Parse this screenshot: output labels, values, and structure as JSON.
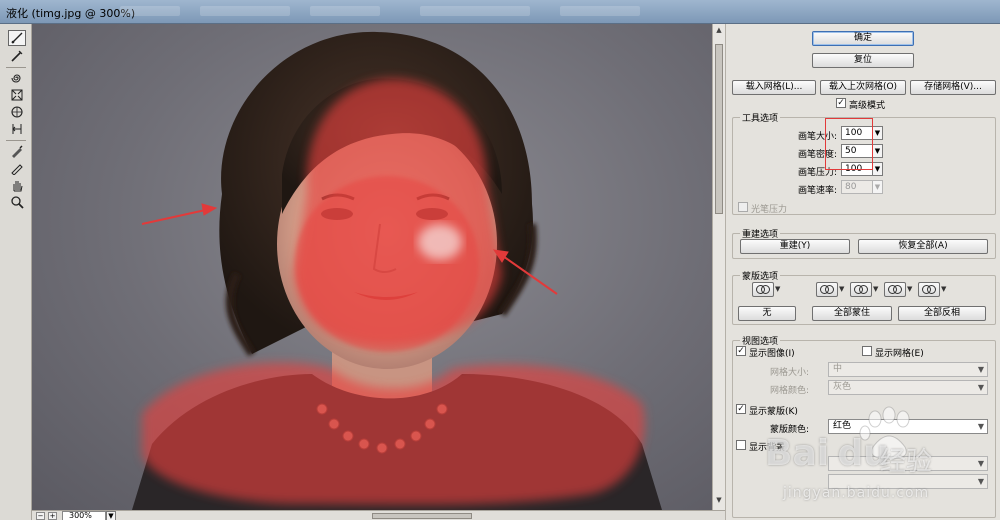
{
  "window": {
    "title": "液化 (timg.jpg @ 300%)"
  },
  "status": {
    "zoom": "300%",
    "zoom_out": "−",
    "zoom_in": "+"
  },
  "panel": {
    "ok": "确定",
    "reset": "复位",
    "load_mesh": "载入网格(L)...",
    "load_last_mesh": "载入上次网格(O)",
    "save_mesh": "存储网格(V)...",
    "advanced_mode": "高级模式",
    "tool_options": {
      "title": "工具选项",
      "brush_size_label": "画笔大小:",
      "brush_size": "100",
      "brush_density_label": "画笔密度:",
      "brush_density": "50",
      "brush_pressure_label": "画笔压力:",
      "brush_pressure": "100",
      "brush_rate_label": "画笔速率:",
      "brush_rate": "80",
      "stylus_pressure": "光笔压力"
    },
    "reconstruct": {
      "title": "重建选项",
      "reconstruct_btn": "重建(Y)",
      "restore_all_btn": "恢复全部(A)"
    },
    "mask": {
      "title": "蒙版选项",
      "none_btn": "无",
      "mask_all_btn": "全部蒙住",
      "invert_all_btn": "全部反相"
    },
    "view": {
      "title": "视图选项",
      "show_image": "显示图像(I)",
      "show_mesh": "显示网格(E)",
      "mesh_size_label": "网格大小:",
      "mesh_size": "中",
      "mesh_color_label": "网格颜色:",
      "mesh_color": "灰色",
      "show_mask": "显示蒙版(K)",
      "mask_color_label": "蒙版颜色:",
      "mask_color": "红色",
      "show_backdrop": "显示背景"
    }
  },
  "watermark": {
    "brand": "Bai",
    "brand2": "du",
    "brand_cn": "经验",
    "url": "jingyan.baidu.com"
  },
  "colors": {
    "mask_red": "#e8403c",
    "accent": "#3d6fb3",
    "annotation": "#e23a3a"
  }
}
